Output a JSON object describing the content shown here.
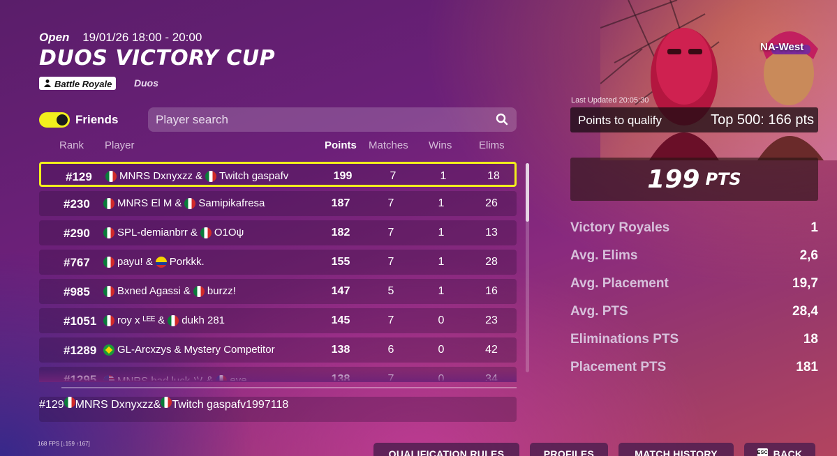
{
  "event": {
    "status": "Open",
    "datetime": "19/01/26 18:00 - 20:00",
    "title": "DUOS VICTORY CUP",
    "mode_badge": "Battle Royale",
    "mode_type": "Duos"
  },
  "filters": {
    "friends_label": "Friends",
    "friends_toggle_on": true,
    "search_placeholder": "Player search"
  },
  "table": {
    "columns": {
      "rank": "Rank",
      "player": "Player",
      "points": "Points",
      "matches": "Matches",
      "wins": "Wins",
      "elims": "Elims"
    },
    "rows": [
      {
        "rank": "#129",
        "p1": "MNRS Dxnyxzz",
        "f1": "mx",
        "p2": "Twitch gaspafv",
        "f2": "mx",
        "points": "199",
        "matches": "7",
        "wins": "1",
        "elims": "18",
        "selected": true
      },
      {
        "rank": "#230",
        "p1": "MNRS El M",
        "f1": "mx",
        "p2": "Samipikafresa",
        "f2": "mx",
        "points": "187",
        "matches": "7",
        "wins": "1",
        "elims": "26"
      },
      {
        "rank": "#290",
        "p1": "SPL-demianbrr",
        "f1": "mx",
        "p2": "O1Oψ",
        "f2": "mx",
        "points": "182",
        "matches": "7",
        "wins": "1",
        "elims": "13"
      },
      {
        "rank": "#767",
        "p1": "payu!",
        "f1": "mx",
        "p2": "Porkkk.",
        "f2": "co",
        "points": "155",
        "matches": "7",
        "wins": "1",
        "elims": "28"
      },
      {
        "rank": "#985",
        "p1": "Bxned Agassi",
        "f1": "mx",
        "p2": "burzz!",
        "f2": "mx",
        "points": "147",
        "matches": "5",
        "wins": "1",
        "elims": "16"
      },
      {
        "rank": "#1051",
        "p1": "roy x ᴸᴱᴱ",
        "f1": "mx",
        "p2": "dukh 281",
        "f2": "mx",
        "points": "145",
        "matches": "7",
        "wins": "0",
        "elims": "23"
      },
      {
        "rank": "#1289",
        "p1": "GL-Arcxzys",
        "f1": "br",
        "p2": "Mystery Competitor",
        "f2": "",
        "points": "138",
        "matches": "6",
        "wins": "0",
        "elims": "42"
      },
      {
        "rank": "#1295",
        "p1": "MNRS bad luck ツ",
        "f1": "us",
        "p2": "eve",
        "f2": "fr",
        "points": "138",
        "matches": "7",
        "wins": "0",
        "elims": "34"
      }
    ],
    "pinned": {
      "rank": "#129",
      "p1": "MNRS Dxnyxzz",
      "f1": "mx",
      "p2": "Twitch gaspafv",
      "f2": "mx",
      "points": "199",
      "matches": "7",
      "wins": "1",
      "elims": "18"
    }
  },
  "side": {
    "region": "NA-West",
    "last_updated": "Last Updated 20:05:30",
    "qualify_label": "Points to qualify",
    "qualify_value": "Top 500: 166 pts",
    "total_points": "199",
    "total_points_unit": "PTS",
    "stats": [
      {
        "label": "Victory Royales",
        "value": "1"
      },
      {
        "label": "Avg. Elims",
        "value": "2,6"
      },
      {
        "label": "Avg. Placement",
        "value": "19,7"
      },
      {
        "label": "Avg. PTS",
        "value": "28,4"
      },
      {
        "label": "Eliminations PTS",
        "value": "18"
      },
      {
        "label": "Placement PTS",
        "value": "181"
      }
    ]
  },
  "footer": {
    "fps": "168 FPS [↓159 ↑167]",
    "buttons": [
      "QUALIFICATION RULES",
      "PROFILES",
      "MATCH HISTORY",
      "BACK"
    ],
    "back_key": "ESC"
  },
  "colors": {
    "highlight": "#f2ef1c",
    "toggle_on": "#f2ef1c"
  }
}
